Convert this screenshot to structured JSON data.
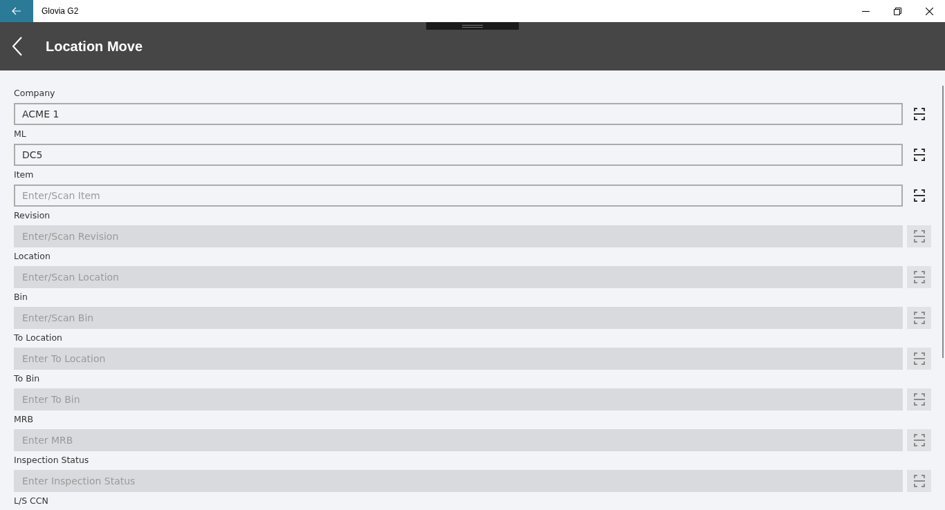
{
  "window": {
    "title": "Glovia G2"
  },
  "header": {
    "title": "Location Move"
  },
  "fields": [
    {
      "label": "Company",
      "value": "ACME 1",
      "disabled": false
    },
    {
      "label": "ML",
      "value": "DC5",
      "disabled": false
    },
    {
      "label": "Item",
      "placeholder": "Enter/Scan Item",
      "disabled": false
    },
    {
      "label": "Revision",
      "placeholder": "Enter/Scan Revision",
      "disabled": true
    },
    {
      "label": "Location",
      "placeholder": "Enter/Scan Location",
      "disabled": true
    },
    {
      "label": "Bin",
      "placeholder": "Enter/Scan Bin",
      "disabled": true
    },
    {
      "label": "To Location",
      "placeholder": "Enter To Location",
      "disabled": true
    },
    {
      "label": "To Bin",
      "placeholder": "Enter To Bin",
      "disabled": true
    },
    {
      "label": "MRB",
      "placeholder": "Enter MRB",
      "disabled": true
    },
    {
      "label": "Inspection Status",
      "placeholder": "Enter Inspection Status",
      "disabled": true
    }
  ],
  "next_field_label": "L/S CCN"
}
